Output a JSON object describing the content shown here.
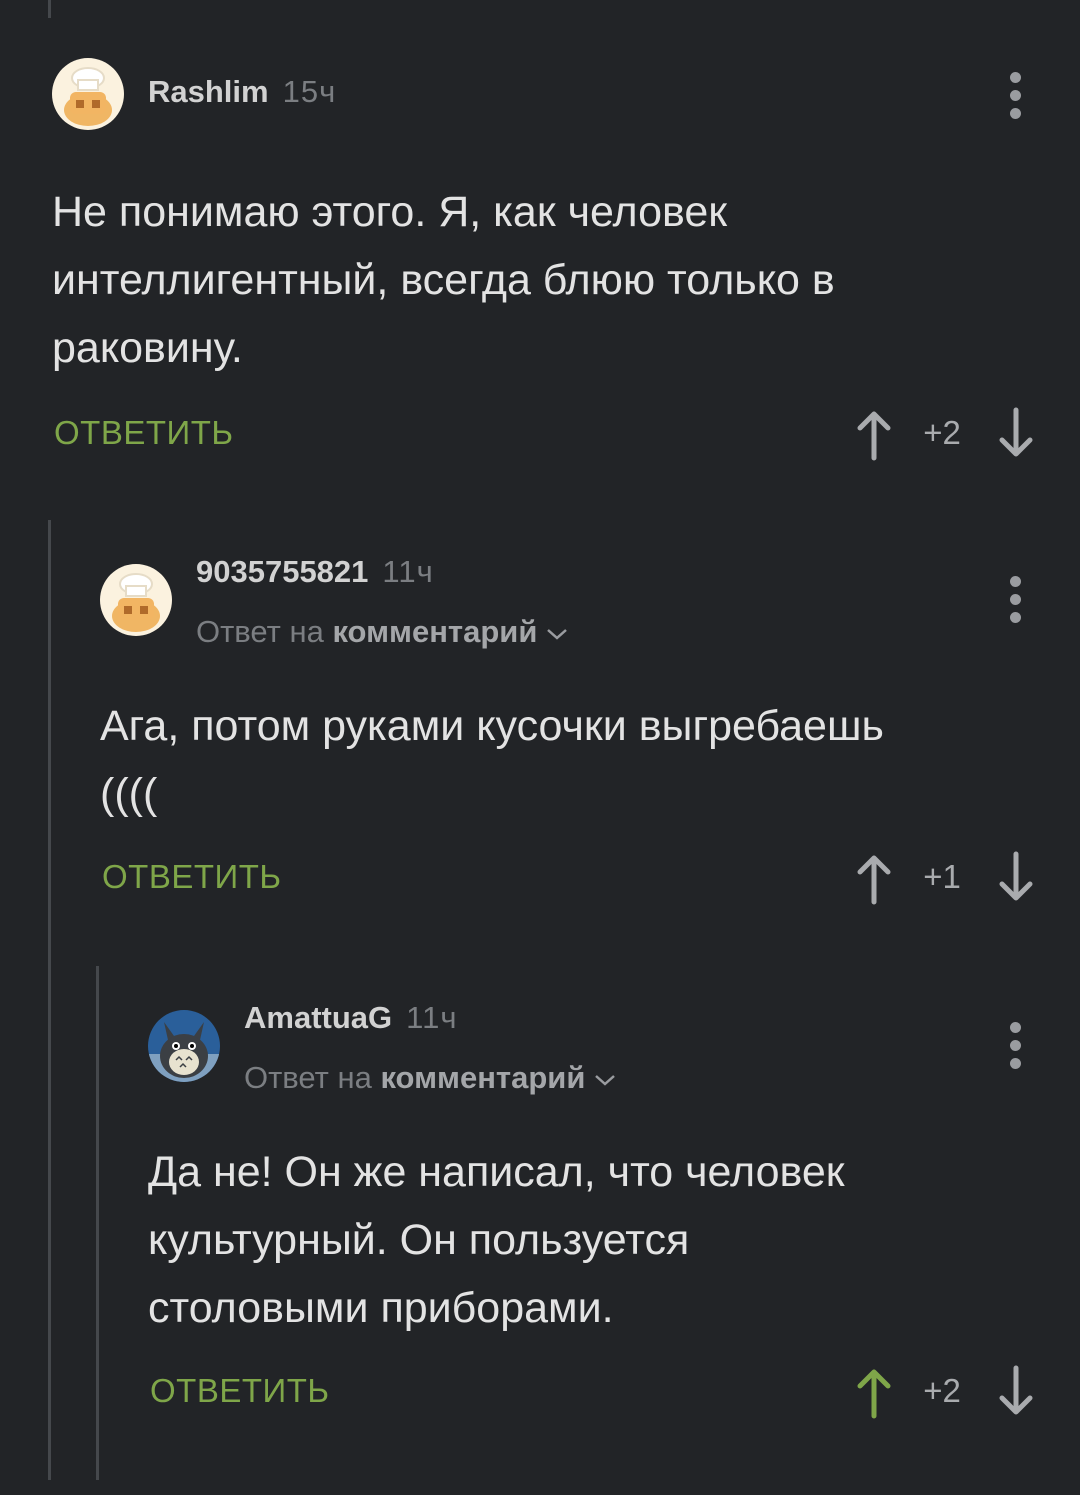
{
  "comments": [
    {
      "author": "Rashlim",
      "time": "15ч",
      "text_lines": [
        "Не понимаю этого. Я, как человек",
        "интеллигентный, всегда блюю только в",
        "раковину."
      ],
      "reply_label": "ОТВЕТИТЬ",
      "score": "+2",
      "upvoted": false
    },
    {
      "author": "9035755821",
      "time": "11ч",
      "reply_prefix": "Ответ на",
      "reply_target": "комментарий",
      "text_lines": [
        "Ага, потом руками кусочки выгребаешь",
        "(((("
      ],
      "reply_label": "ОТВЕТИТЬ",
      "score": "+1",
      "upvoted": false
    },
    {
      "author": "AmattuaG",
      "time": "11ч",
      "reply_prefix": "Ответ на",
      "reply_target": "комментарий",
      "text_lines": [
        "Да не! Он же написал, что человек",
        "культурный. Он пользуется",
        "столовыми приборами."
      ],
      "reply_label": "ОТВЕТИТЬ",
      "score": "+2",
      "upvoted": true
    }
  ],
  "colors": {
    "background": "#222427",
    "accent_green": "#7fa649",
    "thread_line": "#45484c"
  }
}
